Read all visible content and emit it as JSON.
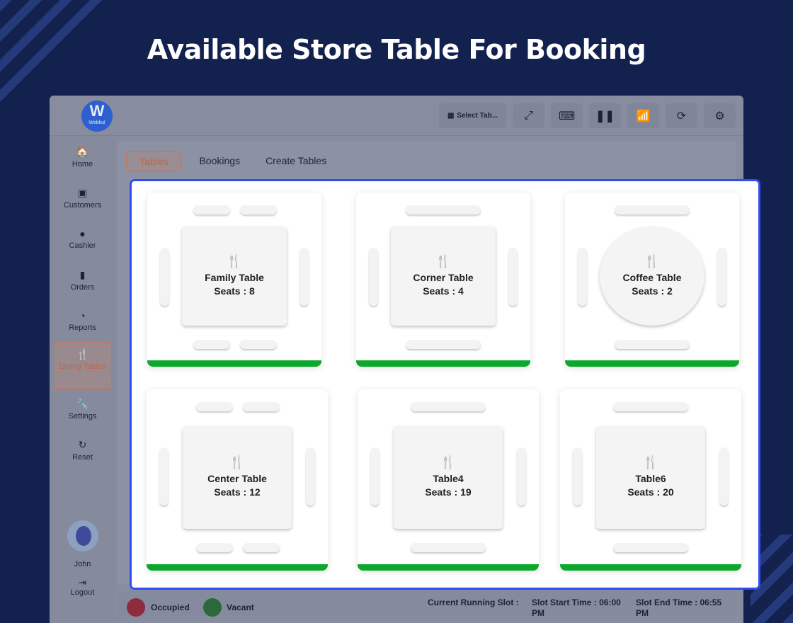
{
  "headline": "Available Store Table For Booking",
  "logo": {
    "letter": "W",
    "name": "Webkul"
  },
  "toolbar": {
    "select_table": "Select Tab..."
  },
  "sidebar": [
    {
      "label": "Home",
      "icon": "🏠"
    },
    {
      "label": "Customers",
      "icon": "▣"
    },
    {
      "label": "Cashier",
      "icon": "●"
    },
    {
      "label": "Orders",
      "icon": "▮"
    },
    {
      "label": "Reports",
      "icon": "◔"
    },
    {
      "label": "Dining Tables",
      "icon": "🍴"
    },
    {
      "label": "Settings",
      "icon": "🔧"
    },
    {
      "label": "Reset",
      "icon": "↻"
    }
  ],
  "user": {
    "name": "John",
    "logout": "Logout"
  },
  "tabs": [
    "Tables",
    "Bookings",
    "Create Tables"
  ],
  "tables": [
    {
      "name": "Family Table",
      "seats": "Seats : 8",
      "status": "vacant"
    },
    {
      "name": "Corner Table",
      "seats": "Seats : 4",
      "status": "vacant"
    },
    {
      "name": "Coffee Table",
      "seats": "Seats : 2",
      "status": "vacant"
    },
    {
      "name": "Center Table",
      "seats": "Seats : 12",
      "status": "vacant"
    },
    {
      "name": "Table4",
      "seats": "Seats : 19",
      "status": "vacant"
    },
    {
      "name": "Table6",
      "seats": "Seats : 20",
      "status": "vacant"
    }
  ],
  "legend": {
    "occupied": "Occupied",
    "vacant": "Vacant",
    "occupied_color": "#8e2c3f",
    "vacant_color": "#2a6a3a"
  },
  "slot": {
    "current": "Current Running Slot :",
    "start": "Slot Start Time : 06:00 PM",
    "end": "Slot End Time : 06:55 PM"
  }
}
